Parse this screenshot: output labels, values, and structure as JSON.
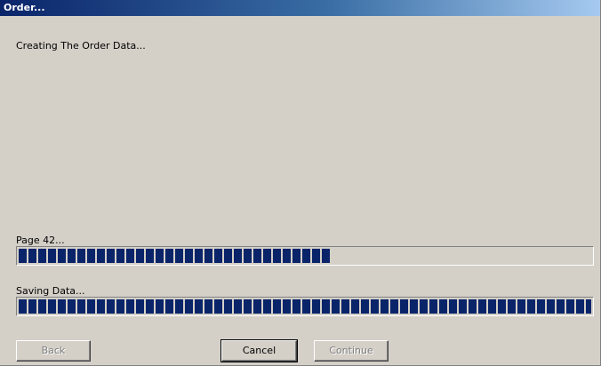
{
  "window": {
    "title": "Order..."
  },
  "message": "Creating The Order Data...",
  "progress": [
    {
      "label": "Page 42...",
      "fraction": 0.545
    },
    {
      "label": "Saving Data...",
      "fraction": 1.0
    }
  ],
  "buttons": {
    "back": "Back",
    "cancel": "Cancel",
    "continue": "Continue"
  },
  "colors": {
    "progress_fill": "#0a246a",
    "title_start": "#0a246a",
    "title_end": "#a6caf0",
    "face": "#d4d0c8"
  }
}
